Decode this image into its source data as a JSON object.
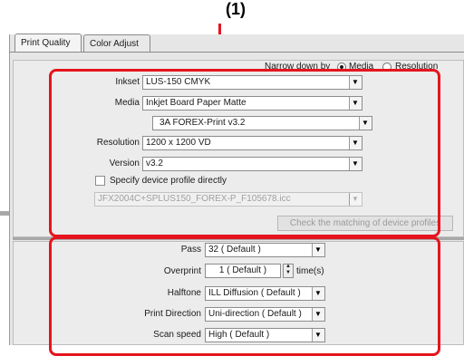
{
  "callout": "(1)",
  "tabs": [
    {
      "label": "Print Quality",
      "active": true
    },
    {
      "label": "Color Adjust",
      "active": false
    }
  ],
  "narrow": {
    "label": "Narrow down by",
    "options": [
      {
        "label": "Media",
        "selected": true
      },
      {
        "label": "Resolution",
        "selected": false
      }
    ]
  },
  "inkset": {
    "label": "Inkset",
    "value": "LUS-150 CMYK"
  },
  "media": {
    "label": "Media",
    "value": "Inkjet Board Paper Matte",
    "sub_value": "3A FOREX-Print v3.2"
  },
  "resolution": {
    "label": "Resolution",
    "value": "1200 x 1200 VD"
  },
  "version": {
    "label": "Version",
    "value": "v3.2"
  },
  "specify_profile": {
    "label": "Specify device profile directly",
    "checked": false,
    "value": "JFX2004C+SPLUS150_FOREX-P_F105678.icc"
  },
  "check_button": "Check the matching of device profiles",
  "pass": {
    "label": "Pass",
    "value": "32 ( Default )"
  },
  "overprint": {
    "label": "Overprint",
    "value": "1 ( Default )",
    "unit": "time(s)"
  },
  "halftone": {
    "label": "Halftone",
    "value": "ILL Diffusion ( Default )"
  },
  "print_direction": {
    "label": "Print Direction",
    "value": "Uni-direction ( Default )"
  },
  "scan_speed": {
    "label": "Scan speed",
    "value": "High ( Default )"
  },
  "colors": {
    "highlight": "#e6141e"
  }
}
